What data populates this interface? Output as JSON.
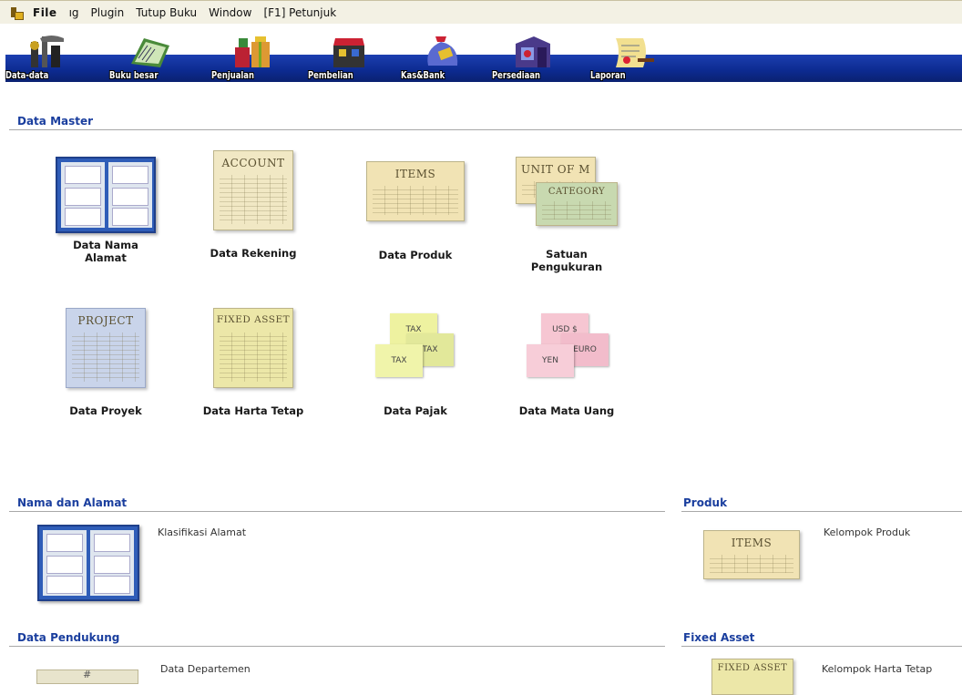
{
  "menubar": {
    "items": [
      "File",
      "ıg",
      "Plugin",
      "Tutup Buku",
      "Window",
      "[F1] Petunjuk"
    ]
  },
  "toolbar": {
    "buttons": [
      {
        "label": "Data-data",
        "icon": "tools-icon"
      },
      {
        "label": "Buku besar",
        "icon": "ledger-icon"
      },
      {
        "label": "Penjualan",
        "icon": "gift-store-icon"
      },
      {
        "label": "Pembelian",
        "icon": "shopping-bag-icon"
      },
      {
        "label": "Kas&Bank",
        "icon": "money-bag-icon"
      },
      {
        "label": "Persediaan",
        "icon": "warehouse-icon"
      },
      {
        "label": "Laporan",
        "icon": "report-scroll-icon"
      }
    ]
  },
  "data_master": {
    "title": "Data Master",
    "tiles": [
      {
        "caption": "Data Nama Alamat"
      },
      {
        "caption": "Data Rekening",
        "sheet": "ACCOUNT"
      },
      {
        "caption": "Data Produk",
        "sheet": "ITEMS"
      },
      {
        "caption": "Satuan Pengukuran",
        "sheet": "UNIT OF M",
        "sheet2": "CATEGORY"
      },
      {
        "caption": "Data Proyek",
        "sheet": "PROJECT"
      },
      {
        "caption": "Data Harta Tetap",
        "sheet": "FIXED ASSET"
      },
      {
        "caption": "Data Pajak",
        "notes": [
          "TAX",
          "TAX",
          "TAX"
        ]
      },
      {
        "caption": "Data Mata Uang",
        "notes": [
          "USD $",
          "EURO",
          "YEN"
        ]
      }
    ]
  },
  "nama_alamat": {
    "title": "Nama dan Alamat",
    "link": "Klasifikasi Alamat"
  },
  "produk": {
    "title": "Produk",
    "sheet": "ITEMS",
    "link": "Kelompok Produk"
  },
  "data_pendukung": {
    "title": "Data Pendukung",
    "link": "Data Departemen"
  },
  "fixed_asset": {
    "title": "Fixed Asset",
    "sheet": "FIXED ASSET",
    "link": "Kelompok Harta Tetap"
  },
  "colors": {
    "section_title": "#1a3e9e",
    "toolbar_band": "#0c2a8f",
    "menubar_bg": "#f3f1e4"
  }
}
